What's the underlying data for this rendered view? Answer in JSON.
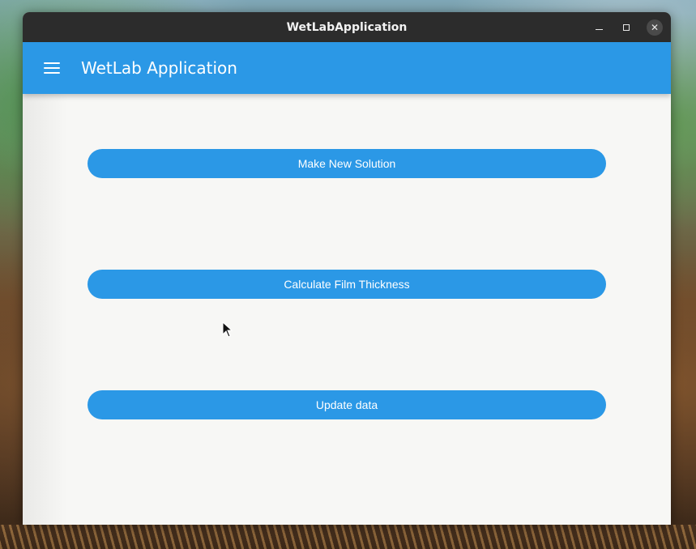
{
  "window": {
    "title": "WetLabApplication",
    "controls": {
      "minimize_icon": "minimize-icon",
      "maximize_icon": "maximize-icon",
      "close_glyph": "✕"
    }
  },
  "appbar": {
    "menu_icon": "hamburger-menu-icon",
    "title": "WetLab Application",
    "color": "#2b98e6"
  },
  "main": {
    "buttons": [
      {
        "label": "Make New Solution"
      },
      {
        "label": "Calculate Film Thickness"
      },
      {
        "label": "Update data"
      }
    ]
  },
  "colors": {
    "accent": "#2b98e6",
    "background": "#f7f7f5",
    "titlebar": "#2c2c2c"
  }
}
